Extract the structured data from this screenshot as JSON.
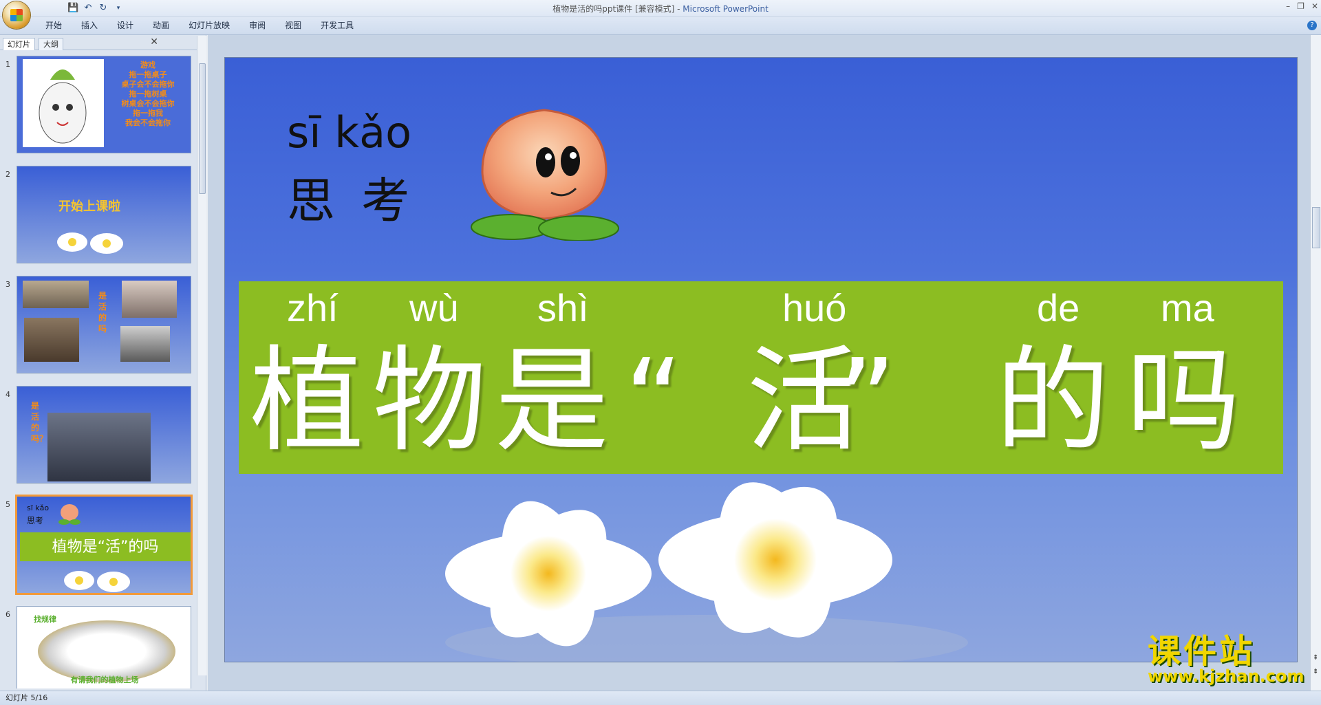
{
  "window": {
    "title": "植物是活的吗ppt课件 [兼容模式]",
    "separator": " - ",
    "app_name": "Microsoft PowerPoint"
  },
  "ribbon": {
    "tabs": [
      "开始",
      "插入",
      "设计",
      "动画",
      "幻灯片放映",
      "审阅",
      "视图",
      "开发工具"
    ]
  },
  "left_pane": {
    "tabs": [
      "幻灯片",
      "大纲"
    ],
    "slides": [
      {
        "num": "1",
        "lines": [
          "游戏",
          "拖一拖桌子",
          "桌子会不会拖你",
          "拖一拖树桌",
          "树桌会不会拖你",
          "拖一拖我",
          "我会不会拖你"
        ]
      },
      {
        "num": "2",
        "title": "开始上课啦"
      },
      {
        "num": "3",
        "side_text": "是活的吗"
      },
      {
        "num": "4",
        "side_text": "是活的吗？"
      },
      {
        "num": "5",
        "pinyin": "sī kǎo",
        "title": "思考",
        "banner": "植物是“活”的吗"
      },
      {
        "num": "6",
        "heading": "找规律",
        "caption": "有请我们的植物上场"
      }
    ]
  },
  "slide": {
    "pinyin_top": "sī kǎo",
    "title_top": "思 考",
    "banner_pinyin": [
      "zhí",
      "wù",
      "shì",
      "huó",
      "de",
      "ma"
    ],
    "banner_text": [
      "植",
      "物",
      "是",
      "“",
      "活",
      "”",
      "的",
      "吗"
    ],
    "colors": {
      "banner": "#8cbd22",
      "sky": "#3a5fd6"
    }
  },
  "status": {
    "slide_indicator": "幻灯片 5/16"
  },
  "watermark": {
    "top": "课件站",
    "bottom": "www.kjzhan.com"
  }
}
